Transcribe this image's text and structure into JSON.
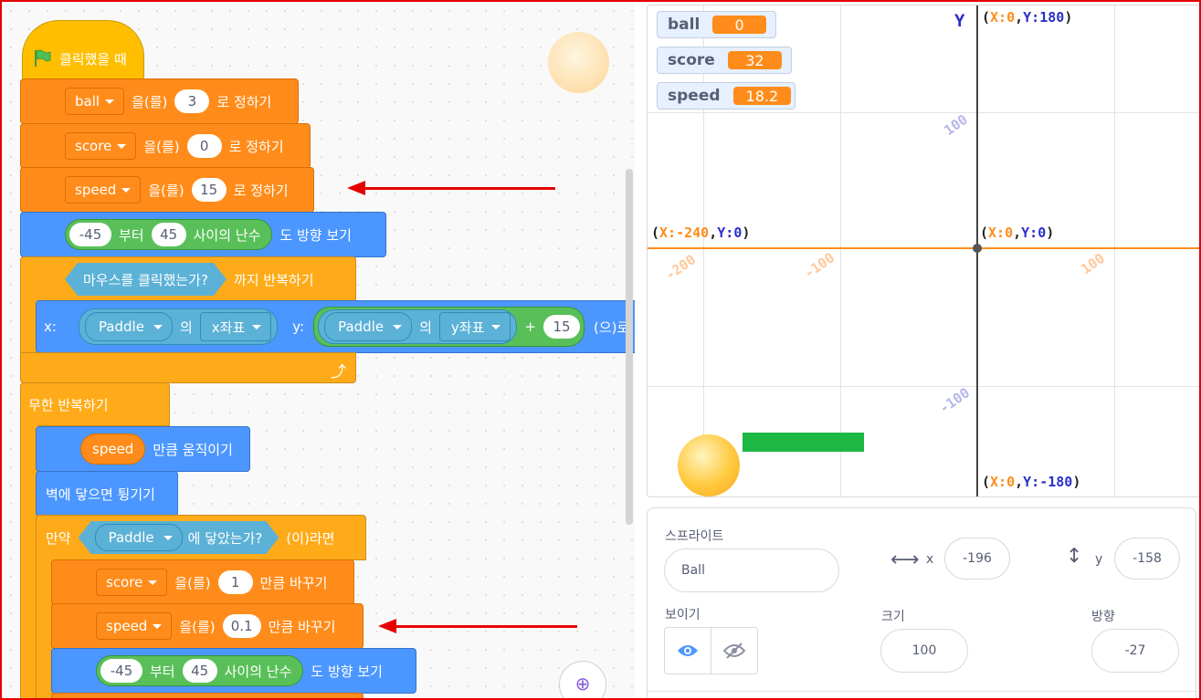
{
  "code": {
    "hat": {
      "label": "클릭했을 때"
    },
    "set_ball": {
      "var": "ball",
      "mid": "을(를)",
      "value": "3",
      "end": "로 정하기"
    },
    "set_score": {
      "var": "score",
      "mid": "을(를)",
      "value": "0",
      "end": "로 정하기"
    },
    "set_speed": {
      "var": "speed",
      "mid": "을(를)",
      "value": "15",
      "end": "로 정하기"
    },
    "point_dir": {
      "from": "-45",
      "w1": "부터",
      "to": "45",
      "w2": "사이의 난수",
      "end": "도 방향 보기"
    },
    "repeat_until": {
      "cond": "마우스를 클릭했는가?",
      "end": "까지 반복하기"
    },
    "goto": {
      "xlabel": "x:",
      "sprite1": "Paddle",
      "of1": "의",
      "prop1": "x좌표",
      "ylabel": "y:",
      "sprite2": "Paddle",
      "of2": "의",
      "prop2": "y좌표",
      "plus": "+",
      "add": "15",
      "end": "(으)로"
    },
    "forever": {
      "label": "무한 반복하기"
    },
    "move": {
      "var": "speed",
      "end": "만큼 움직이기"
    },
    "bounce": {
      "label": "벽에 닿으면 튕기기"
    },
    "if_touch": {
      "if": "만약",
      "sprite": "Paddle",
      "cond": "에 닿았는가?",
      "then": "(이)라면"
    },
    "change_score": {
      "var": "score",
      "mid": "을(를)",
      "value": "1",
      "end": "만큼 바꾸기"
    },
    "change_speed": {
      "var": "speed",
      "mid": "을(를)",
      "value": "0.1",
      "end": "만큼 바꾸기"
    },
    "point_dir2": {
      "from": "-45",
      "w1": "부터",
      "to": "45",
      "w2": "사이의 난수",
      "end": "도 방향 보기"
    }
  },
  "stage": {
    "monitors": [
      {
        "name": "ball",
        "value": "0"
      },
      {
        "name": "score",
        "value": "32"
      },
      {
        "name": "speed",
        "value": "18.2"
      }
    ],
    "axis_y_label": "Y",
    "top": {
      "open": "(",
      "xk": "X:",
      "xv": "0",
      "sep": ",",
      "yk": "Y:",
      "yv": "180",
      "close": ")"
    },
    "left": {
      "open": "(",
      "xk": "X:",
      "xv": "-240",
      "sep": ",",
      "yk": "Y:",
      "yv": "0",
      "close": ")"
    },
    "center": {
      "open": "(",
      "xk": "X:",
      "xv": "0",
      "sep": ",",
      "yk": "Y:",
      "yv": "0",
      "close": ")"
    },
    "bottom": {
      "open": "(",
      "xk": "X:",
      "xv": "0",
      "sep": ",",
      "yk": "Y:",
      "yv": "-180",
      "close": ")"
    },
    "ticks": {
      "y_pos": "100",
      "y_neg": "-100",
      "x_neg200": "-200",
      "x_neg100": "-100",
      "x_pos100": "100"
    }
  },
  "sprite_info": {
    "sprite_label": "스프라이트",
    "sprite_name": "Ball",
    "x_label": "x",
    "x_value": "-196",
    "y_label": "y",
    "y_value": "-158",
    "show_label": "보이기",
    "size_label": "크기",
    "size_value": "100",
    "direction_label": "방향",
    "direction_value": "-27"
  },
  "colors": {
    "motion": "#4c97ff",
    "variables": "#ff8c1a",
    "control": "#ffab19",
    "events": "#ffbf00",
    "operators": "#59c059",
    "sensing": "#5cb1d6",
    "annotation": "#e60000"
  }
}
